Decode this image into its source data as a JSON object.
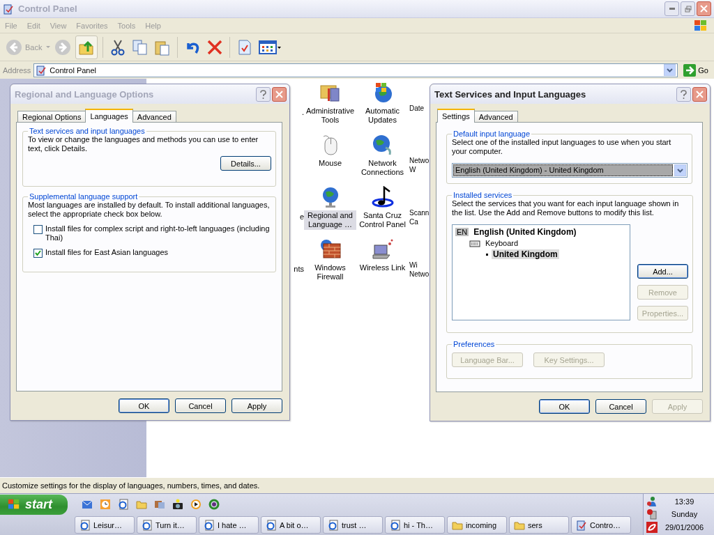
{
  "window": {
    "title": "Control Panel"
  },
  "menu": [
    "File",
    "Edit",
    "View",
    "Favorites",
    "Tools",
    "Help"
  ],
  "toolbar": {
    "back": "Back"
  },
  "address": {
    "label": "Address",
    "value": "Control Panel",
    "go": "Go"
  },
  "icon_rows": [
    {
      "left_fragment": ".",
      "items": [
        {
          "label": "Administrative Tools",
          "kind": "tools",
          "selected": false
        },
        {
          "label": "Automatic Updates",
          "kind": "updates",
          "selected": false
        }
      ],
      "right_fragment": "Date"
    },
    {
      "items": [
        {
          "label": "Mouse",
          "kind": "mouse",
          "selected": false
        },
        {
          "label": "Network Connections",
          "kind": "network",
          "selected": false
        }
      ],
      "right_fragment": "Netwo W"
    },
    {
      "left_fragment": "e",
      "items": [
        {
          "label": "Regional and Language …",
          "kind": "globe",
          "selected": true
        },
        {
          "label": "Santa Cruz Control Panel",
          "kind": "music",
          "selected": false
        }
      ],
      "right_fragment": "Scann Ca"
    },
    {
      "left_fragment": "nts",
      "items": [
        {
          "label": "Windows Firewall",
          "kind": "firewall",
          "selected": false
        },
        {
          "label": "Wireless Link",
          "kind": "wireless",
          "selected": false
        }
      ],
      "right_fragment": "Wi Netwo"
    }
  ],
  "status_bar": "Customize settings for the display of languages, numbers, times, and dates.",
  "regional_dialog": {
    "title": "Regional and Language Options",
    "tabs": [
      {
        "label": "Regional Options",
        "selected": false
      },
      {
        "label": "Languages",
        "selected": true
      },
      {
        "label": "Advanced",
        "selected": false
      }
    ],
    "text_services": {
      "title": "Text services and input languages",
      "text": "To view or change the languages and methods you can use to enter text, click Details.",
      "button": "Details..."
    },
    "supplemental": {
      "title": "Supplemental language support",
      "text": "Most languages are installed by default. To install additional languages, select the appropriate check box below.",
      "checkboxes": [
        {
          "label": "Install files for complex script and right-to-left languages (including Thai)",
          "checked": false
        },
        {
          "label": "Install files for East Asian languages",
          "checked": true
        }
      ]
    },
    "buttons": [
      {
        "label": "OK",
        "disabled": false
      },
      {
        "label": "Cancel",
        "disabled": false
      },
      {
        "label": "Apply",
        "disabled": false
      }
    ]
  },
  "text_services_dialog": {
    "title": "Text Services and Input Languages",
    "tabs": [
      {
        "label": "Settings",
        "selected": true
      },
      {
        "label": "Advanced",
        "selected": false
      }
    ],
    "default_language": {
      "title": "Default input language",
      "text": "Select one of the installed input languages to use when you start your computer.",
      "value": "English (United Kingdom) - United Kingdom"
    },
    "installed": {
      "title": "Installed services",
      "text": "Select the services that you want for each input language shown in the list. Use the Add and Remove buttons to modify this list.",
      "tree": [
        {
          "badge": "EN",
          "label": "English (United Kingdom)",
          "selected": false,
          "children": [
            {
              "label": "Keyboard",
              "selected": false,
              "children": [
                {
                  "label": "United Kingdom",
                  "selected": true
                }
              ]
            }
          ]
        }
      ],
      "buttons": [
        {
          "label": "Add...",
          "disabled": false
        },
        {
          "label": "Remove",
          "disabled": true
        },
        {
          "label": "Properties...",
          "disabled": true
        }
      ]
    },
    "preferences": {
      "title": "Preferences",
      "buttons": [
        {
          "label": "Language Bar...",
          "disabled": true
        },
        {
          "label": "Key Settings...",
          "disabled": true
        }
      ]
    },
    "buttons": [
      {
        "label": "OK",
        "disabled": false
      },
      {
        "label": "Cancel",
        "disabled": false
      },
      {
        "label": "Apply",
        "disabled": true
      }
    ]
  },
  "taskbar": {
    "start": "start",
    "quick_launch": [
      {
        "kind": "outlook"
      },
      {
        "kind": "clock"
      },
      {
        "kind": "ie"
      },
      {
        "kind": "folder"
      },
      {
        "kind": "media"
      },
      {
        "kind": "camera"
      },
      {
        "kind": "player"
      },
      {
        "kind": "network"
      }
    ],
    "tasks": [
      {
        "label": "Leisur…",
        "kind": "ie"
      },
      {
        "label": "Turn it…",
        "kind": "ie"
      },
      {
        "label": "I hate …",
        "kind": "ie"
      },
      {
        "label": "A bit o…",
        "kind": "ie"
      },
      {
        "label": "trust …",
        "kind": "ie"
      },
      {
        "label": "hi - Th…",
        "kind": "ie"
      },
      {
        "label": "incoming",
        "kind": "folder"
      },
      {
        "label": "sers",
        "kind": "folder"
      },
      {
        "label": "Contro…",
        "kind": "cpl"
      }
    ],
    "clock": {
      "time": "13:39",
      "day": "Sunday",
      "date": "29/01/2006"
    }
  }
}
